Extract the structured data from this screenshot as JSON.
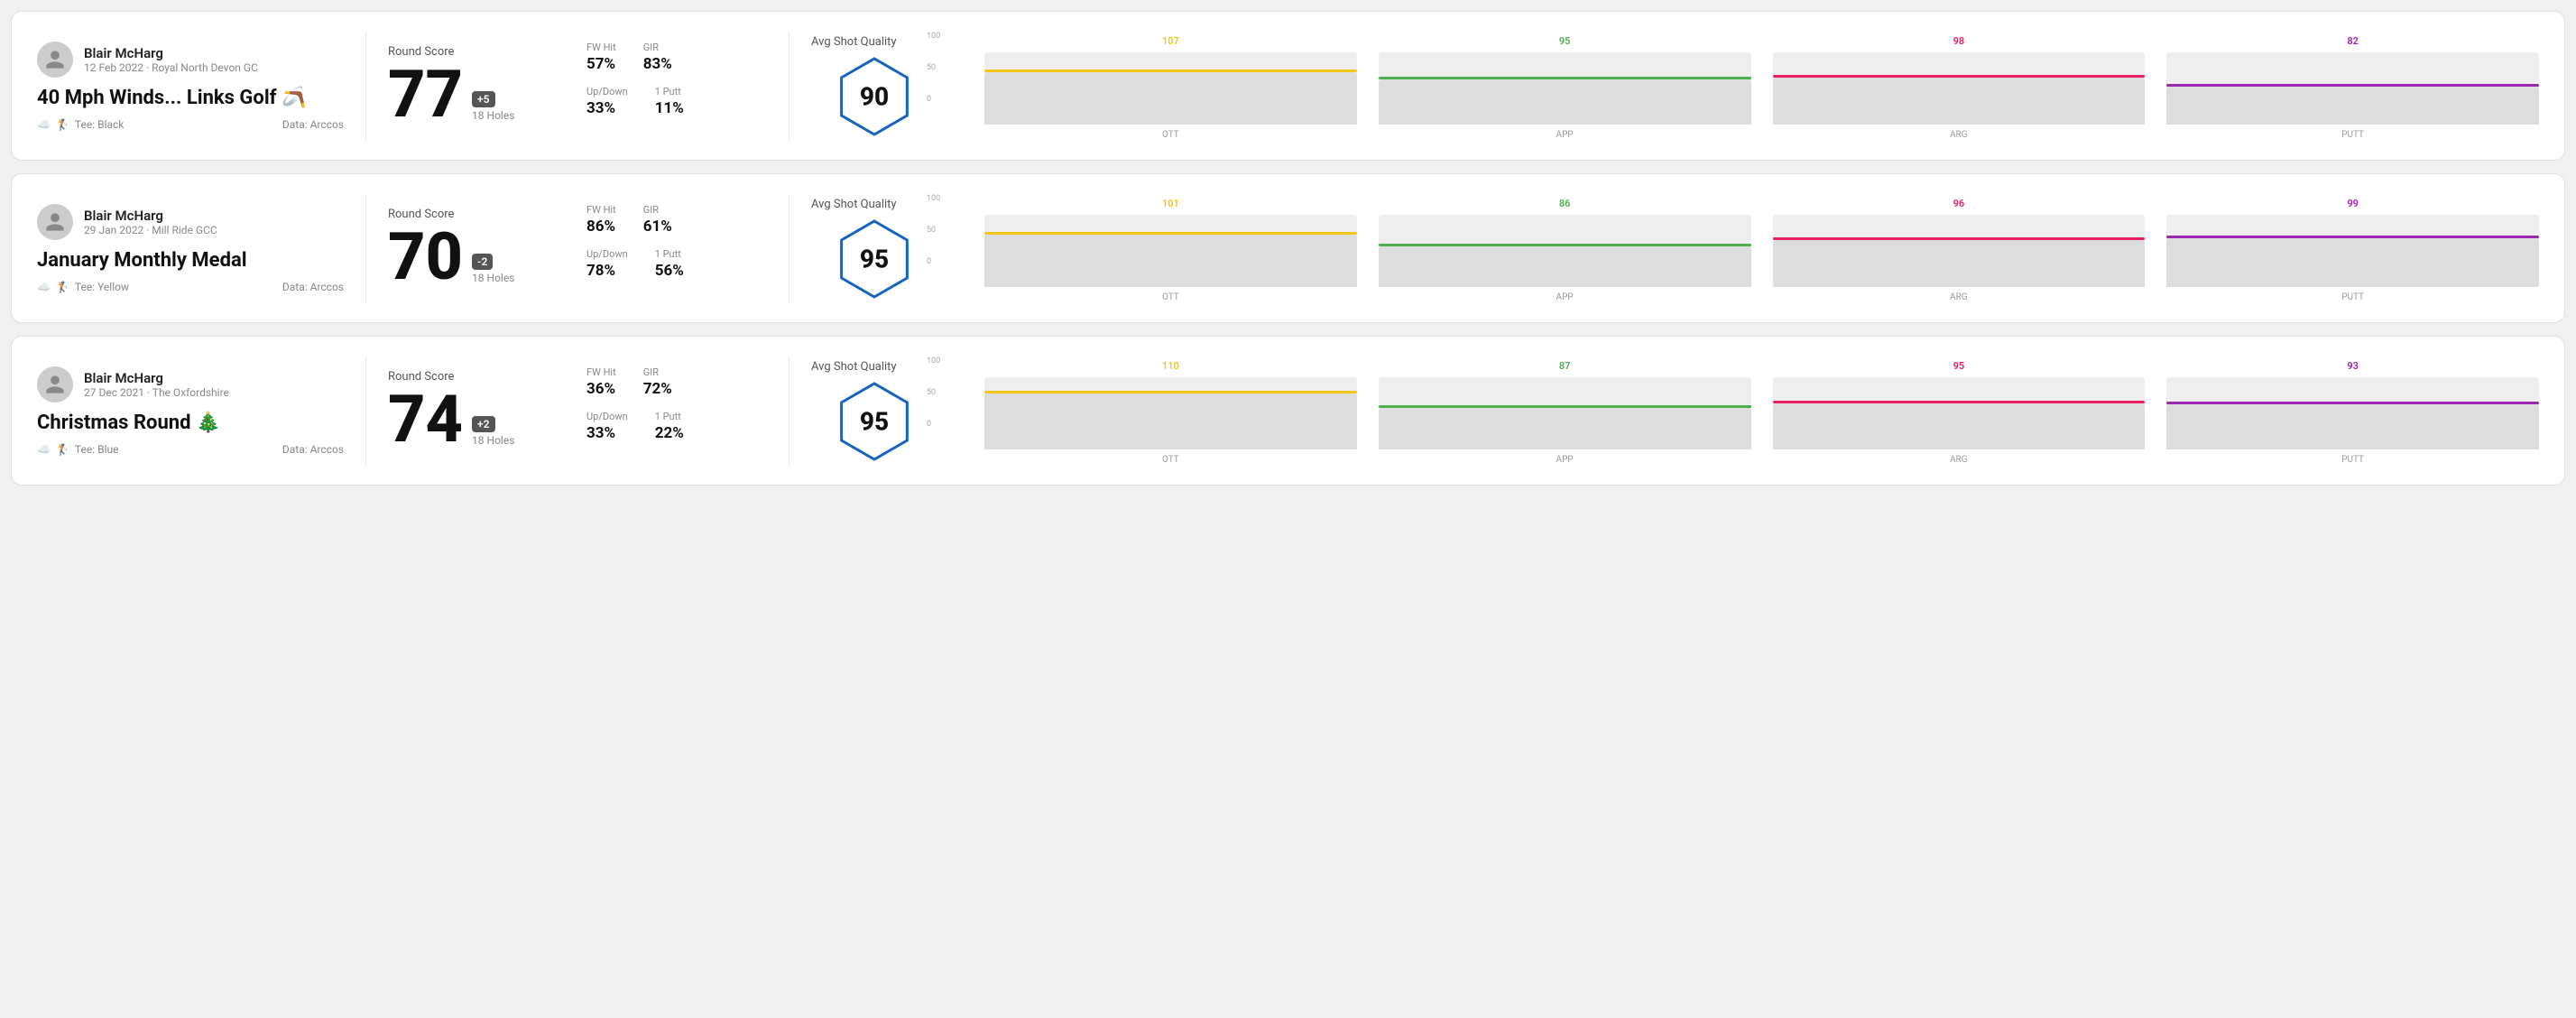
{
  "rounds": [
    {
      "id": "round-1",
      "player_name": "Blair McHarg",
      "date": "12 Feb 2022 · Royal North Devon GC",
      "title": "40 Mph Winds... Links Golf 🪃",
      "tee": "Black",
      "data_source": "Data: Arccos",
      "score": "77",
      "score_diff": "+5",
      "score_holes": "18 Holes",
      "fw_hit": "57%",
      "gir": "83%",
      "up_down": "33%",
      "one_putt": "11%",
      "avg_shot_quality": "90",
      "chart": {
        "y_labels": [
          "100",
          "50",
          "0"
        ],
        "cols": [
          {
            "label": "OTT",
            "value": 107,
            "color": "#f5c518",
            "bar_height_pct": 72
          },
          {
            "label": "APP",
            "value": 95,
            "color": "#4caf50",
            "bar_height_pct": 62
          },
          {
            "label": "ARG",
            "value": 98,
            "color": "#e91e63",
            "bar_height_pct": 65
          },
          {
            "label": "PUTT",
            "value": 82,
            "color": "#9c27b0",
            "bar_height_pct": 52
          }
        ]
      }
    },
    {
      "id": "round-2",
      "player_name": "Blair McHarg",
      "date": "29 Jan 2022 · Mill Ride GCC",
      "title": "January Monthly Medal",
      "tee": "Yellow",
      "data_source": "Data: Arccos",
      "score": "70",
      "score_diff": "-2",
      "score_holes": "18 Holes",
      "fw_hit": "86%",
      "gir": "61%",
      "up_down": "78%",
      "one_putt": "56%",
      "avg_shot_quality": "95",
      "chart": {
        "y_labels": [
          "100",
          "50",
          "0"
        ],
        "cols": [
          {
            "label": "OTT",
            "value": 101,
            "color": "#f5c518",
            "bar_height_pct": 72
          },
          {
            "label": "APP",
            "value": 86,
            "color": "#4caf50",
            "bar_height_pct": 56
          },
          {
            "label": "ARG",
            "value": 96,
            "color": "#e91e63",
            "bar_height_pct": 65
          },
          {
            "label": "PUTT",
            "value": 99,
            "color": "#9c27b0",
            "bar_height_pct": 68
          }
        ]
      }
    },
    {
      "id": "round-3",
      "player_name": "Blair McHarg",
      "date": "27 Dec 2021 · The Oxfordshire",
      "title": "Christmas Round 🎄",
      "tee": "Blue",
      "data_source": "Data: Arccos",
      "score": "74",
      "score_diff": "+2",
      "score_holes": "18 Holes",
      "fw_hit": "36%",
      "gir": "72%",
      "up_down": "33%",
      "one_putt": "22%",
      "avg_shot_quality": "95",
      "chart": {
        "y_labels": [
          "100",
          "50",
          "0"
        ],
        "cols": [
          {
            "label": "OTT",
            "value": 110,
            "color": "#f5c518",
            "bar_height_pct": 78
          },
          {
            "label": "APP",
            "value": 87,
            "color": "#4caf50",
            "bar_height_pct": 57
          },
          {
            "label": "ARG",
            "value": 95,
            "color": "#e91e63",
            "bar_height_pct": 64
          },
          {
            "label": "PUTT",
            "value": 93,
            "color": "#9c27b0",
            "bar_height_pct": 62
          }
        ]
      }
    }
  ],
  "labels": {
    "round_score": "Round Score",
    "avg_shot_quality": "Avg Shot Quality",
    "fw_hit": "FW Hit",
    "gir": "GIR",
    "up_down": "Up/Down",
    "one_putt": "1 Putt",
    "tee_prefix": "Tee:"
  }
}
